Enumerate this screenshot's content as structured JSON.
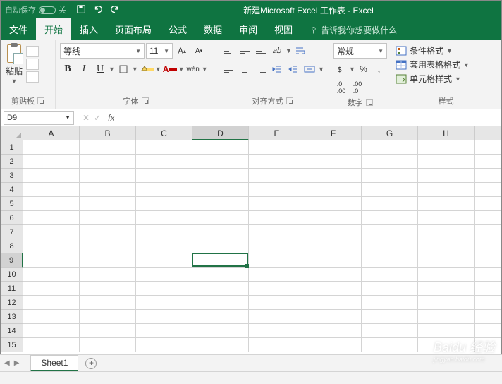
{
  "titlebar": {
    "autosave": "自动保存",
    "title": "新建Microsoft Excel 工作表 - Excel"
  },
  "tabs": [
    "文件",
    "开始",
    "插入",
    "页面布局",
    "公式",
    "数据",
    "审阅",
    "视图"
  ],
  "activeTab": 1,
  "tellme": "告诉我你想要做什么",
  "clipboard": {
    "paste": "粘贴",
    "label": "剪贴板"
  },
  "font": {
    "name": "等线",
    "size": "11",
    "label": "字体",
    "wen": "wén"
  },
  "align": {
    "label": "对齐方式"
  },
  "number": {
    "format": "常规",
    "label": "数字"
  },
  "styles": {
    "cond": "条件格式",
    "table": "套用表格格式",
    "cell": "单元格样式",
    "label": "样式"
  },
  "namebox": "D9",
  "fx": "fx",
  "cols": [
    "A",
    "B",
    "C",
    "D",
    "E",
    "F",
    "G",
    "H"
  ],
  "rows": [
    "1",
    "2",
    "3",
    "4",
    "5",
    "6",
    "7",
    "8",
    "9",
    "10",
    "11",
    "12",
    "13",
    "14",
    "15"
  ],
  "selCol": 3,
  "selRow": 8,
  "sheet": "Sheet1",
  "watermark": {
    "main": "Baidu 经验",
    "sub": "jingyan.baidu.com"
  }
}
